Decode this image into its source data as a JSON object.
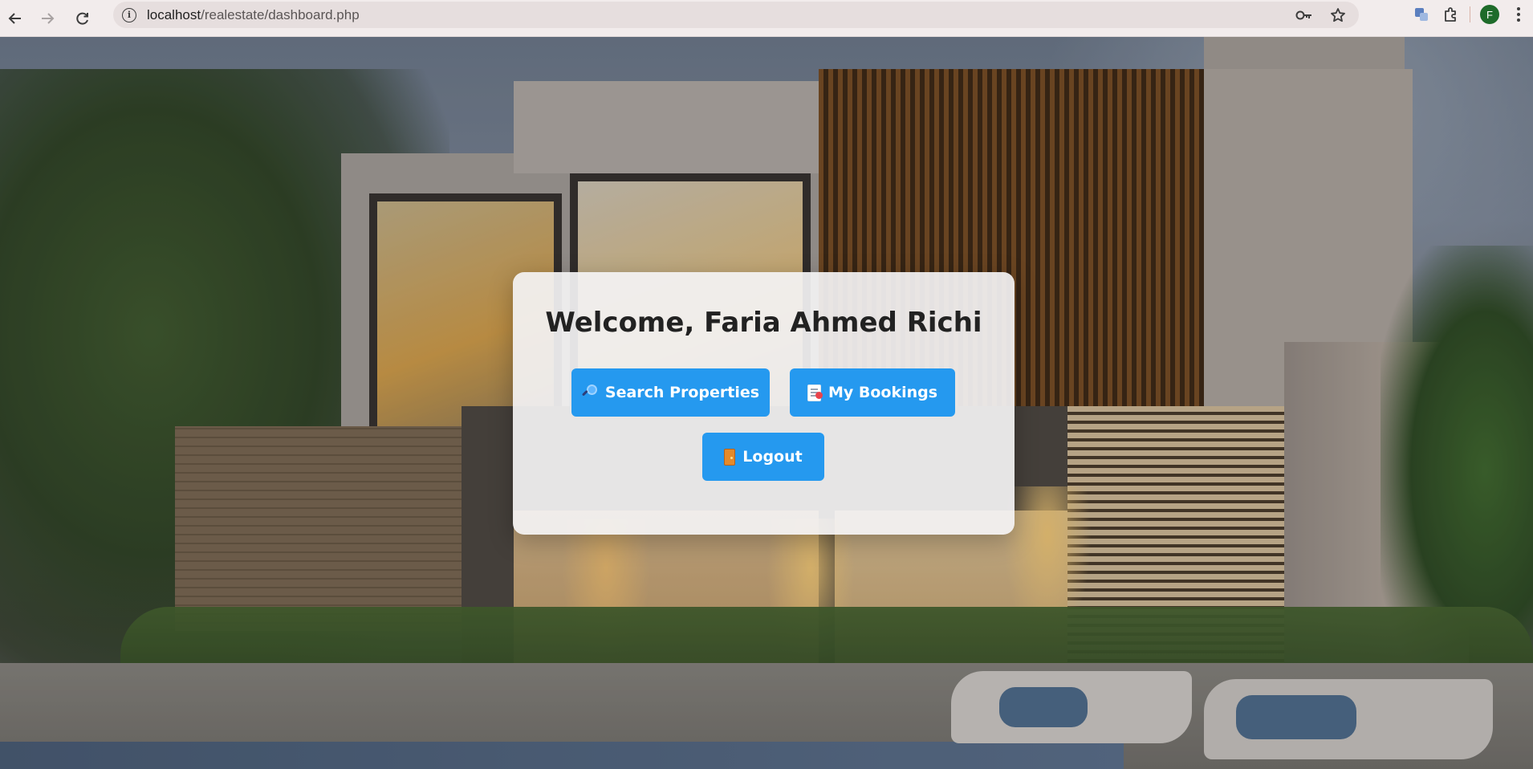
{
  "browser": {
    "back_icon": "arrow-left-icon",
    "forward_icon": "arrow-right-icon",
    "reload_icon": "reload-icon",
    "url_host": "localhost",
    "url_path": "/realestate/dashboard.php",
    "profile_initial": "F",
    "profile_color": "#1e6b2a"
  },
  "dashboard": {
    "welcome_title": "Welcome, Faria Ahmed Richi",
    "buttons": {
      "search_label": "Search Properties",
      "search_icon": "magnifying-glass-icon",
      "bookings_label": "My Bookings",
      "bookings_icon": "document-icon",
      "logout_label": "Logout",
      "logout_icon": "door-icon"
    },
    "accent_color": "#2599ef"
  }
}
